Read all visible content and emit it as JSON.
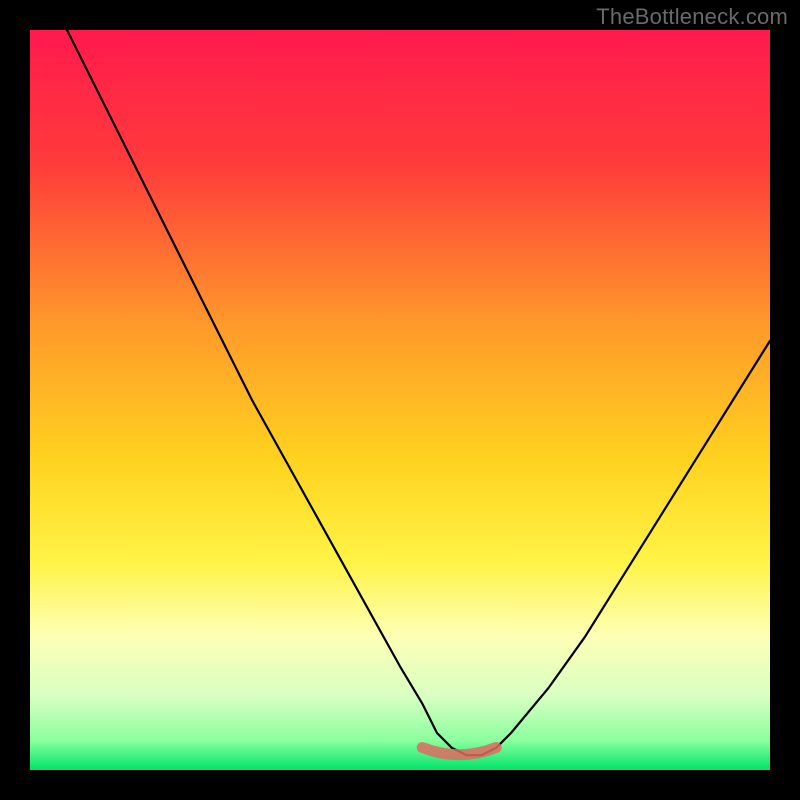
{
  "watermark": "TheBottleneck.com",
  "colors": {
    "border": "#000000",
    "curve": "#000000",
    "optimal_marker": "#e06a62",
    "gradient_stops": [
      {
        "offset": "0%",
        "color": "#ff1a4d"
      },
      {
        "offset": "18%",
        "color": "#ff3b3b"
      },
      {
        "offset": "40%",
        "color": "#ff9a2a"
      },
      {
        "offset": "58%",
        "color": "#ffd21f"
      },
      {
        "offset": "72%",
        "color": "#fff447"
      },
      {
        "offset": "82%",
        "color": "#fdffb6"
      },
      {
        "offset": "90%",
        "color": "#d9ffc2"
      },
      {
        "offset": "96%",
        "color": "#8aff9e"
      },
      {
        "offset": "100%",
        "color": "#00e46a"
      }
    ]
  },
  "chart_data": {
    "type": "line",
    "title": "",
    "xlabel": "",
    "ylabel": "",
    "xlim": [
      0,
      100
    ],
    "ylim": [
      0,
      100
    ],
    "legend": false,
    "grid": false,
    "series": [
      {
        "name": "bottleneck-curve",
        "x": [
          5,
          10,
          15,
          20,
          25,
          30,
          35,
          40,
          45,
          50,
          53,
          55,
          57,
          59,
          61,
          63,
          65,
          70,
          75,
          80,
          85,
          90,
          95,
          100
        ],
        "values": [
          100,
          90,
          80,
          70,
          60,
          50,
          41,
          32,
          23,
          14,
          9,
          5,
          3,
          2,
          2,
          3,
          5,
          11,
          18,
          26,
          34,
          42,
          50,
          58
        ]
      }
    ],
    "optimal_range_x": [
      53,
      63
    ],
    "optimal_marker_y": 2.5,
    "annotations": []
  }
}
